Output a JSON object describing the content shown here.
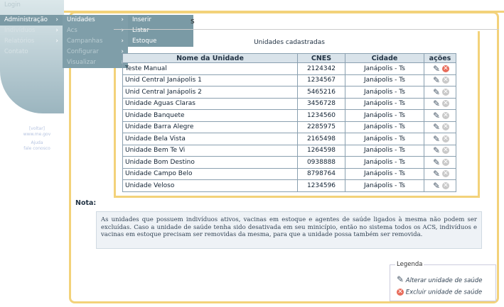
{
  "menu_level1": [
    "Login",
    "Administração",
    "Indivíduos",
    "Relatórios",
    "Contato"
  ],
  "menu_level2": [
    "Unidades",
    "Acs",
    "Campanhas",
    "Configurar",
    "Visualizar"
  ],
  "menu_level3": [
    "Inserir",
    "Listar",
    "Estoque"
  ],
  "title_fragment": "s",
  "sidebar_links": [
    "[voltar]",
    "www.me.gov",
    "Ajuda",
    "fale conosco"
  ],
  "table": {
    "caption": "Unidades cadastradas",
    "headers": [
      "Nome da Unidade",
      "CNES",
      "Cidade",
      "ações"
    ],
    "rows": [
      {
        "name": "Teste Manual",
        "cnes": "2124342",
        "city": "Janápolis - Ts",
        "delete_enabled": true
      },
      {
        "name": "Unid Central Janápolis 1",
        "cnes": "1234567",
        "city": "Janápolis - Ts",
        "delete_enabled": false
      },
      {
        "name": "Unid Central Janápolis 2",
        "cnes": "5465216",
        "city": "Janápolis - Ts",
        "delete_enabled": false
      },
      {
        "name": "Unidade Aguas Claras",
        "cnes": "3456728",
        "city": "Janápolis - Ts",
        "delete_enabled": false
      },
      {
        "name": "Unidade Banquete",
        "cnes": "1234560",
        "city": "Janápolis - Ts",
        "delete_enabled": false
      },
      {
        "name": "Unidade Barra Alegre",
        "cnes": "2285975",
        "city": "Janápolis - Ts",
        "delete_enabled": false
      },
      {
        "name": "Unidade Bela Vista",
        "cnes": "2165498",
        "city": "Janápolis - Ts",
        "delete_enabled": false
      },
      {
        "name": "Unidade Bem Te Vi",
        "cnes": "1264598",
        "city": "Janápolis - Ts",
        "delete_enabled": false
      },
      {
        "name": "Unidade Bom Destino",
        "cnes": "0938888",
        "city": "Janápolis - Ts",
        "delete_enabled": false
      },
      {
        "name": "Unidade Campo Belo",
        "cnes": "8798764",
        "city": "Janápolis - Ts",
        "delete_enabled": false
      },
      {
        "name": "Unidade Veloso",
        "cnes": "1234596",
        "city": "Janápolis - Ts",
        "delete_enabled": false
      }
    ]
  },
  "note": {
    "label": "Nota:",
    "text": "As unidades que possuem indivíduos ativos, vacinas em estoque e agentes de saúde ligados à mesma não podem ser excluídas. Caso a unidade de saúde tenha sido desativada em seu minicípio, então no sistema todos os ACS, indivíduos e vacinas em estoque precisam ser removidas da mesma, para que a unidade possa também ser removida."
  },
  "legend": {
    "title": "Legenda",
    "edit": "Alterar unidade de saúde",
    "delete": "Excluir unidade de saúde"
  },
  "icons": {
    "edit": "pencil-icon",
    "delete": "delete-icon"
  },
  "colors": {
    "menu_active": "#7b9aa5",
    "frame": "#f3d27a",
    "delete_active": "#e86b5a"
  }
}
